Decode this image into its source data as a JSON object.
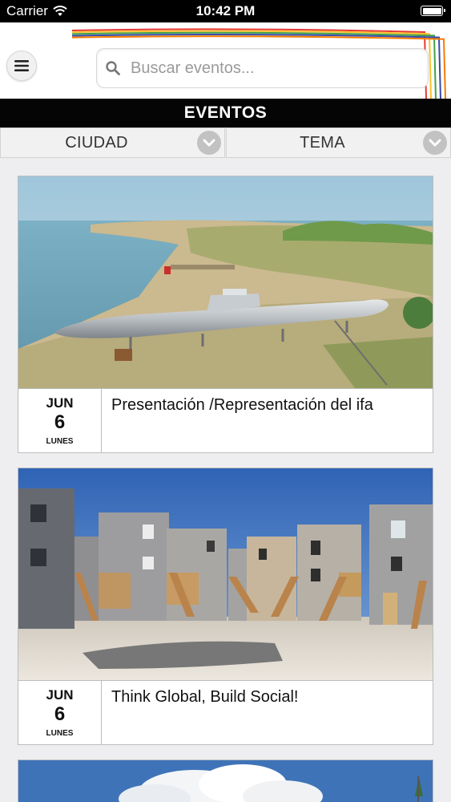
{
  "status_bar": {
    "carrier": "Carrier",
    "time": "10:42 PM"
  },
  "header": {
    "search_placeholder": "Buscar eventos...",
    "deco_colors": [
      "#e53935",
      "#fbc02d",
      "#43a047",
      "#3949ab",
      "#f57c00"
    ]
  },
  "section": {
    "title": "EVENTOS"
  },
  "filters": [
    {
      "label": "CIUDAD"
    },
    {
      "label": "TEMA"
    }
  ],
  "events": [
    {
      "month": "JUN",
      "day": "6",
      "weekday": "LUNES",
      "title": "Presentación /Representación del ifa"
    },
    {
      "month": "JUN",
      "day": "6",
      "weekday": "LUNES",
      "title": "Think Global, Build Social!"
    }
  ]
}
